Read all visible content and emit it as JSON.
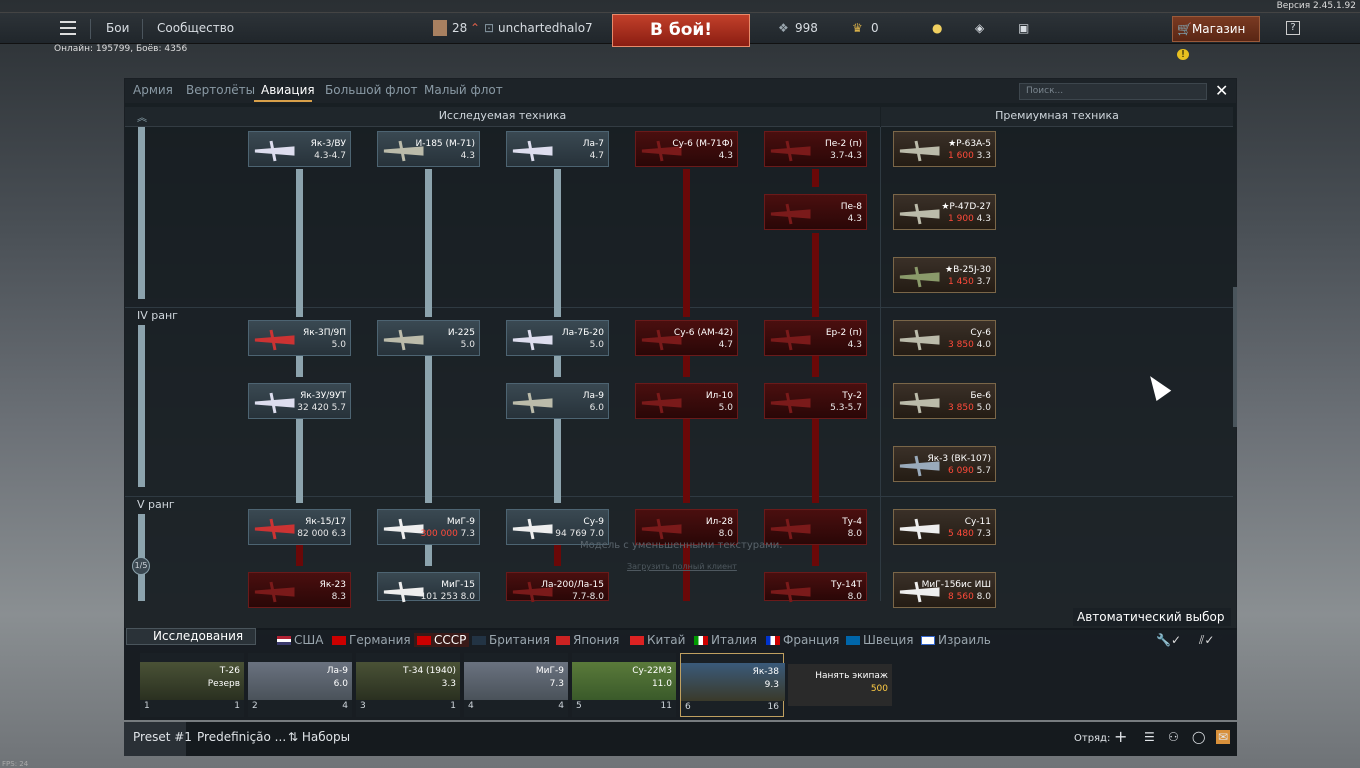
{
  "version": "Версия 2.45.1.92",
  "online": "Онлайн: 195799, Боёв: 4356",
  "topbar": {
    "battles": "Бои",
    "community": "Сообщество",
    "level": "28",
    "username": "unchartedhalo7",
    "battle_button": "В бой!",
    "silver": "998",
    "gold": "0",
    "shop": "Магазин"
  },
  "tabs": [
    "Армия",
    "Вертолёты",
    "Авиация",
    "Большой флот",
    "Малый флот"
  ],
  "search_placeholder": "Поиск...",
  "col_research": "Исследуемая техника",
  "col_premium": "Премиумная техника",
  "ranks": {
    "r4": "IV ранг",
    "r5": "V ранг",
    "page": "1/5"
  },
  "cards": [
    {
      "n": "Як-3/ВУ",
      "b": "4.3-4.7"
    },
    {
      "n": "И-185 (М-71)",
      "b": "4.3"
    },
    {
      "n": "Ла-7",
      "b": "4.7"
    },
    {
      "n": "Су-6 (М-71Ф)",
      "b": "4.3"
    },
    {
      "n": "Пе-2 (п)",
      "b": "3.7-4.3"
    },
    {
      "n": "Пе-8",
      "b": "4.3"
    },
    {
      "n": "Як-3П/9П",
      "b": "5.0"
    },
    {
      "n": "И-225",
      "b": "5.0"
    },
    {
      "n": "Ла-7Б-20",
      "b": "5.0"
    },
    {
      "n": "Су-6 (АМ-42)",
      "b": "4.7"
    },
    {
      "n": "Ер-2 (п)",
      "b": "4.3"
    },
    {
      "n": "Як-3У/9УТ",
      "b": "32 420",
      "br": "5.7"
    },
    {
      "n": "Ла-9",
      "b": "6.0"
    },
    {
      "n": "Ил-10",
      "b": "5.0"
    },
    {
      "n": "Ту-2",
      "b": "5.3-5.7"
    },
    {
      "n": "Як-15/17",
      "b": "82 000",
      "br": "6.3"
    },
    {
      "n": "МиГ-9",
      "b": "300 000",
      "br": "7.3"
    },
    {
      "n": "Су-9",
      "b": "94 769",
      "br": "7.0"
    },
    {
      "n": "Ил-28",
      "b": "8.0"
    },
    {
      "n": "Ту-4",
      "b": "8.0"
    },
    {
      "n": "Як-23",
      "b": "8.3"
    },
    {
      "n": "МиГ-15",
      "b": "101 253",
      "br": "8.0"
    },
    {
      "n": "Ла-200/Ла-15",
      "b": "7.7-8.0"
    },
    {
      "n": "Ту-14Т",
      "b": "8.0"
    }
  ],
  "premium": [
    {
      "n": "★P-63A-5",
      "p": "1 600",
      "b": "3.3"
    },
    {
      "n": "★P-47D-27",
      "p": "1 900",
      "b": "4.3"
    },
    {
      "n": "★B-25J-30",
      "p": "1 450",
      "b": "3.7"
    },
    {
      "n": "Су-6",
      "p": "3 850",
      "b": "4.0"
    },
    {
      "n": "Бе-6",
      "p": "3 850",
      "b": "5.0"
    },
    {
      "n": "Як-3 (ВК-107)",
      "p": "6 090",
      "b": "5.7"
    },
    {
      "n": "Су-11",
      "p": "5 480",
      "b": "7.3"
    },
    {
      "n": "МиГ-15бис ИШ",
      "p": "8 560",
      "b": "8.0"
    }
  ],
  "overlay_text": "Модель с уменьшенными текстурами.",
  "overlay_link": "Загрузить полный клиент",
  "auto_select": "Автоматический выбор",
  "research_tab": "Исследования",
  "nations": [
    "США",
    "Германия",
    "СССР",
    "Британия",
    "Япония",
    "Китай",
    "Италия",
    "Франция",
    "Швеция",
    "Израиль"
  ],
  "slots": [
    {
      "n": "Т-26",
      "v": "Резерв",
      "num": "1",
      "cnt": "1"
    },
    {
      "n": "Ла-9",
      "v": "6.0",
      "num": "2",
      "cnt": "4"
    },
    {
      "n": "Т-34 (1940)",
      "v": "3.3",
      "num": "3",
      "cnt": "1"
    },
    {
      "n": "МиГ-9",
      "v": "7.3",
      "num": "4",
      "cnt": "4"
    },
    {
      "n": "Су-22М3",
      "v": "11.0",
      "num": "5",
      "cnt": "11"
    },
    {
      "n": "Як-38",
      "v": "9.3",
      "num": "6",
      "cnt": "16"
    },
    {
      "n": "Нанять экипаж",
      "v": "500",
      "num": "",
      "cnt": ""
    }
  ],
  "footer": {
    "preset1": "Preset #1",
    "preset2": "Predefinição ...",
    "sets": "Наборы",
    "squad": "Отряд:"
  },
  "fps": "FPS: 24"
}
